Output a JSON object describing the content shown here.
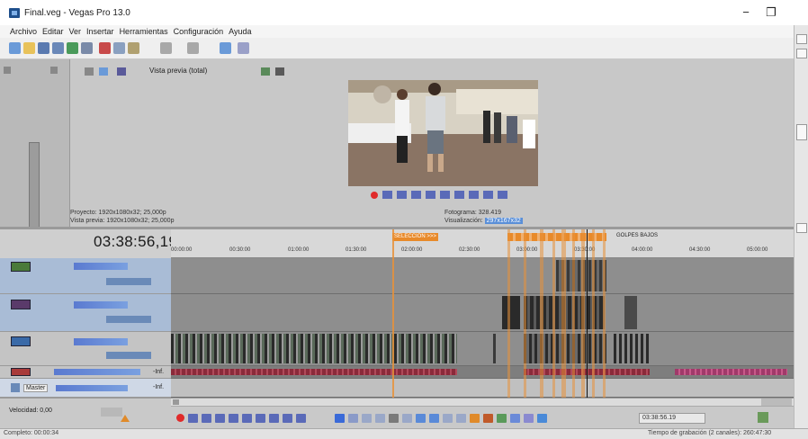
{
  "window": {
    "title": "Final.veg - Vegas Pro 13.0",
    "minimize_glyph": "−",
    "maximize_glyph": "❐"
  },
  "menu": {
    "items": [
      "Archivo",
      "Editar",
      "Ver",
      "Insertar",
      "Herramientas",
      "Configuración",
      "Ayuda"
    ]
  },
  "preview": {
    "mode_label": "Vista previa (total)",
    "project_label": "Proyecto:",
    "project_value": "1920x1080x32; 25,000p",
    "preview_label": "Vista previa:",
    "preview_value": "1920x1080x32; 25,000p",
    "frame_label": "Fotograma:",
    "frame_value": "328.419",
    "display_label": "Visualización:",
    "display_value": "297x167x32"
  },
  "timeline": {
    "timecode": "03:38:56,19",
    "ruler_ticks": [
      "00:00:00",
      "00:30:00",
      "01:00:00",
      "01:30:00",
      "02:00:00",
      "02:30:00",
      "03:00:00",
      "03:30:00",
      "04:00:00",
      "04:30:00",
      "05:00:00"
    ],
    "markers": [
      {
        "label": "SELECCION >>>",
        "style": "orange"
      },
      {
        "label": "GOLPES BAJOS",
        "style": "plain"
      }
    ],
    "master_label": "Master",
    "master_vol": "-Inf.",
    "track_vol": "-Inf.",
    "speed_label": "Velocidad: 0,00",
    "position_field": "03:38:56.19"
  },
  "status": {
    "left": "Completo: 00:00:34",
    "right": "Tiempo de grabación (2 canales): 260:47:30"
  },
  "colors": {
    "accent": "#e8923a",
    "selected_track": "#a9bcd6",
    "record_red": "#e02a2a"
  }
}
